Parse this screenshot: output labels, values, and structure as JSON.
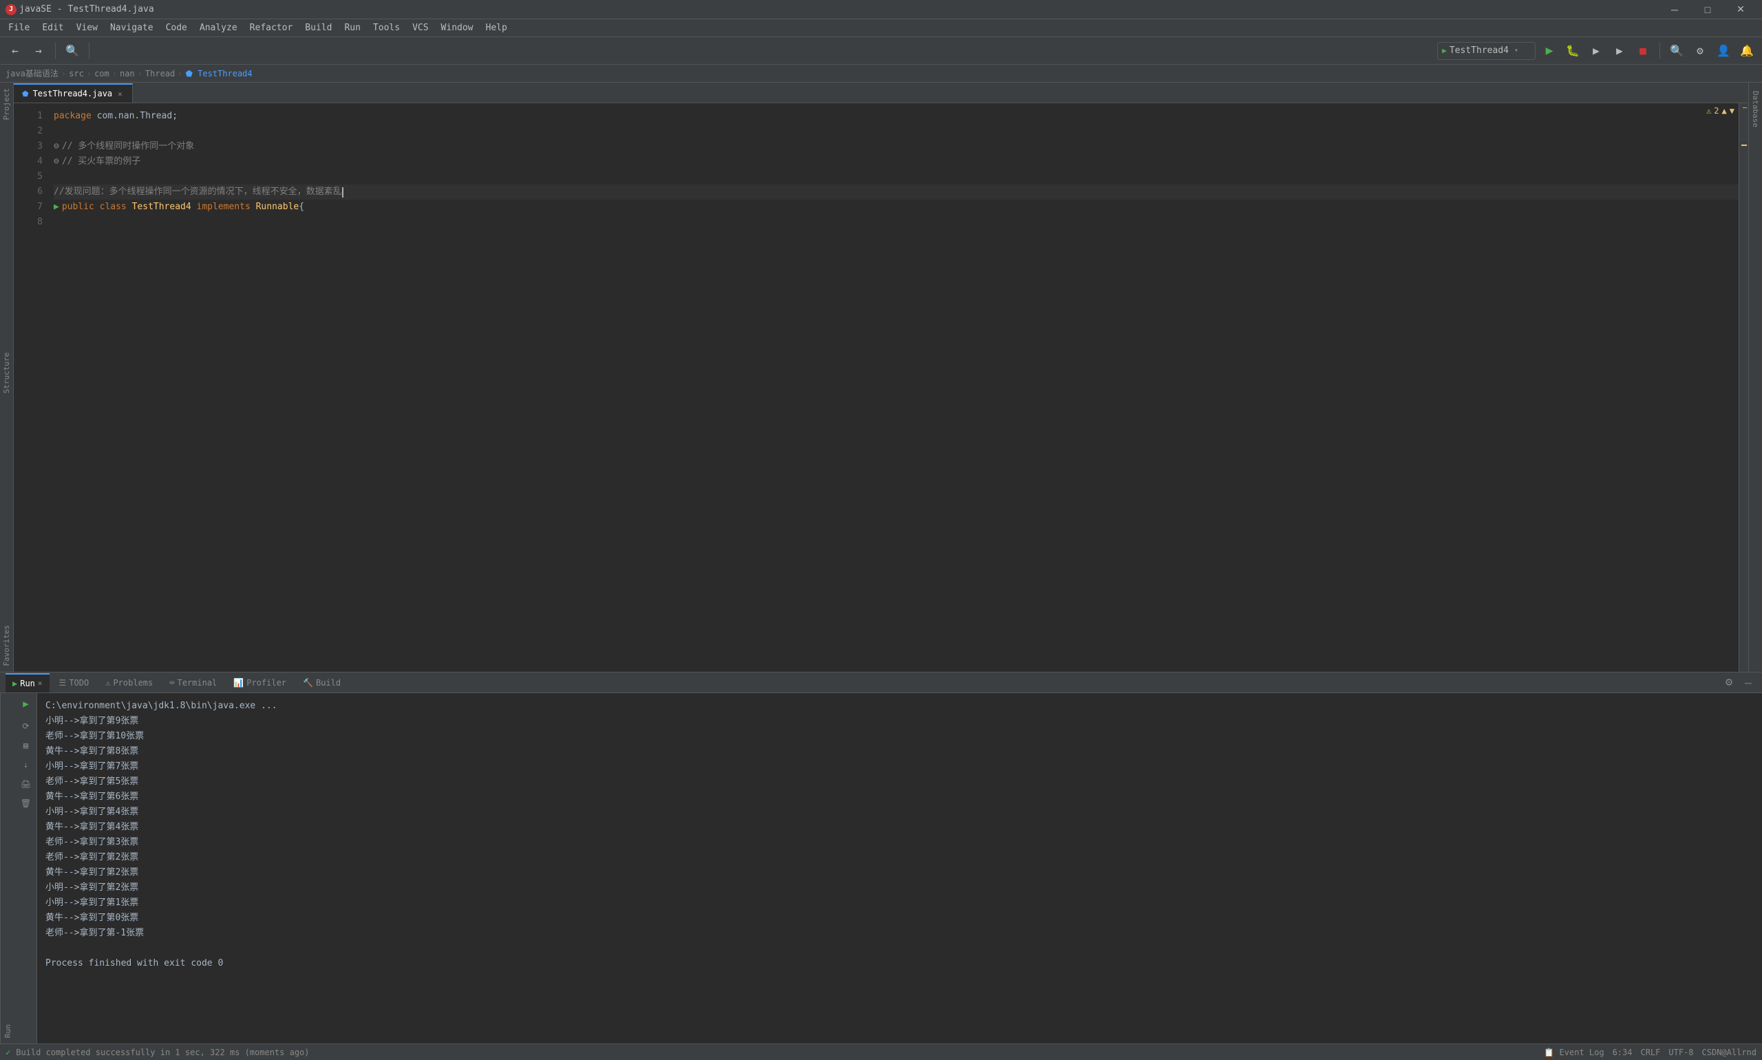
{
  "titleBar": {
    "icon": "J",
    "title": "javaSE - TestThread4.java",
    "minimizeLabel": "─",
    "maximizeLabel": "□",
    "closeLabel": "✕"
  },
  "menuBar": {
    "items": [
      "File",
      "Edit",
      "View",
      "Navigate",
      "Code",
      "Analyze",
      "Refactor",
      "Build",
      "Run",
      "Tools",
      "VCS",
      "Window",
      "Help"
    ]
  },
  "breadcrumb": {
    "items": [
      "java基础语法",
      "src",
      "com",
      "nan",
      "Thread",
      "TestThread4"
    ]
  },
  "toolbar": {
    "configDropdown": "TestThread4",
    "runLabel": "▶",
    "debugLabel": "🐛",
    "coverageLabel": "▶",
    "profileLabel": "▶"
  },
  "editor": {
    "filename": "TestThread4.java",
    "warningCount": "2",
    "lines": [
      {
        "num": 1,
        "content": "package com.nan.Thread;",
        "type": "normal"
      },
      {
        "num": 2,
        "content": "",
        "type": "normal"
      },
      {
        "num": 3,
        "content": "// 多个线程同时操作同一个对象",
        "type": "comment"
      },
      {
        "num": 4,
        "content": "// 买火车票的例子",
        "type": "comment"
      },
      {
        "num": 5,
        "content": "",
        "type": "normal"
      },
      {
        "num": 6,
        "content": "//发现问题：多个线程操作同一个资源的情况下，线程不安全，数据紊乱",
        "type": "comment"
      },
      {
        "num": 7,
        "content": "public class TestThread4 implements Runnable{",
        "type": "code"
      },
      {
        "num": 8,
        "content": "",
        "type": "normal"
      }
    ]
  },
  "runPanel": {
    "tabLabel": "TestThread4",
    "commandLine": "C:\\environment\\java\\jdk1.8\\bin\\java.exe ...",
    "output": [
      "小明-->拿到了第9张票",
      "老师-->拿到了第10张票",
      "黄牛-->拿到了第8张票",
      "小明-->拿到了第7张票",
      "老师-->拿到了第5张票",
      "黄牛-->拿到了第6张票",
      "小明-->拿到了第4张票",
      "黄牛-->拿到了第4张票",
      "老师-->拿到了第3张票",
      "老师-->拿到了第2张票",
      "黄牛-->拿到了第2张票",
      "小明-->拿到了第2张票",
      "小明-->拿到了第1张票",
      "黄牛-->拿到了第0张票",
      "老师-->拿到了第-1张票"
    ],
    "finishMessage": "Process finished with exit code 0"
  },
  "bottomTabs": [
    {
      "label": "Run",
      "icon": "▶",
      "active": true
    },
    {
      "label": "TODO",
      "icon": "☰",
      "active": false
    },
    {
      "label": "Problems",
      "icon": "⚠",
      "active": false
    },
    {
      "label": "Terminal",
      "icon": "⌨",
      "active": false
    },
    {
      "label": "Profiler",
      "icon": "📊",
      "active": false
    },
    {
      "label": "Build",
      "icon": "🔨",
      "active": false
    }
  ],
  "statusBar": {
    "buildMessage": "Build completed successfully in 1 sec, 322 ms (moments ago)",
    "time": "6:34",
    "lineEnding": "CRLF",
    "encoding": "UTF-8",
    "user": "CSDN@Allrnd",
    "eventLog": "Event Log"
  },
  "rightPanel": {
    "label": "Database"
  },
  "leftToolPanels": [
    {
      "label": "Project"
    },
    {
      "label": "Structure"
    },
    {
      "label": "Favorites"
    }
  ]
}
